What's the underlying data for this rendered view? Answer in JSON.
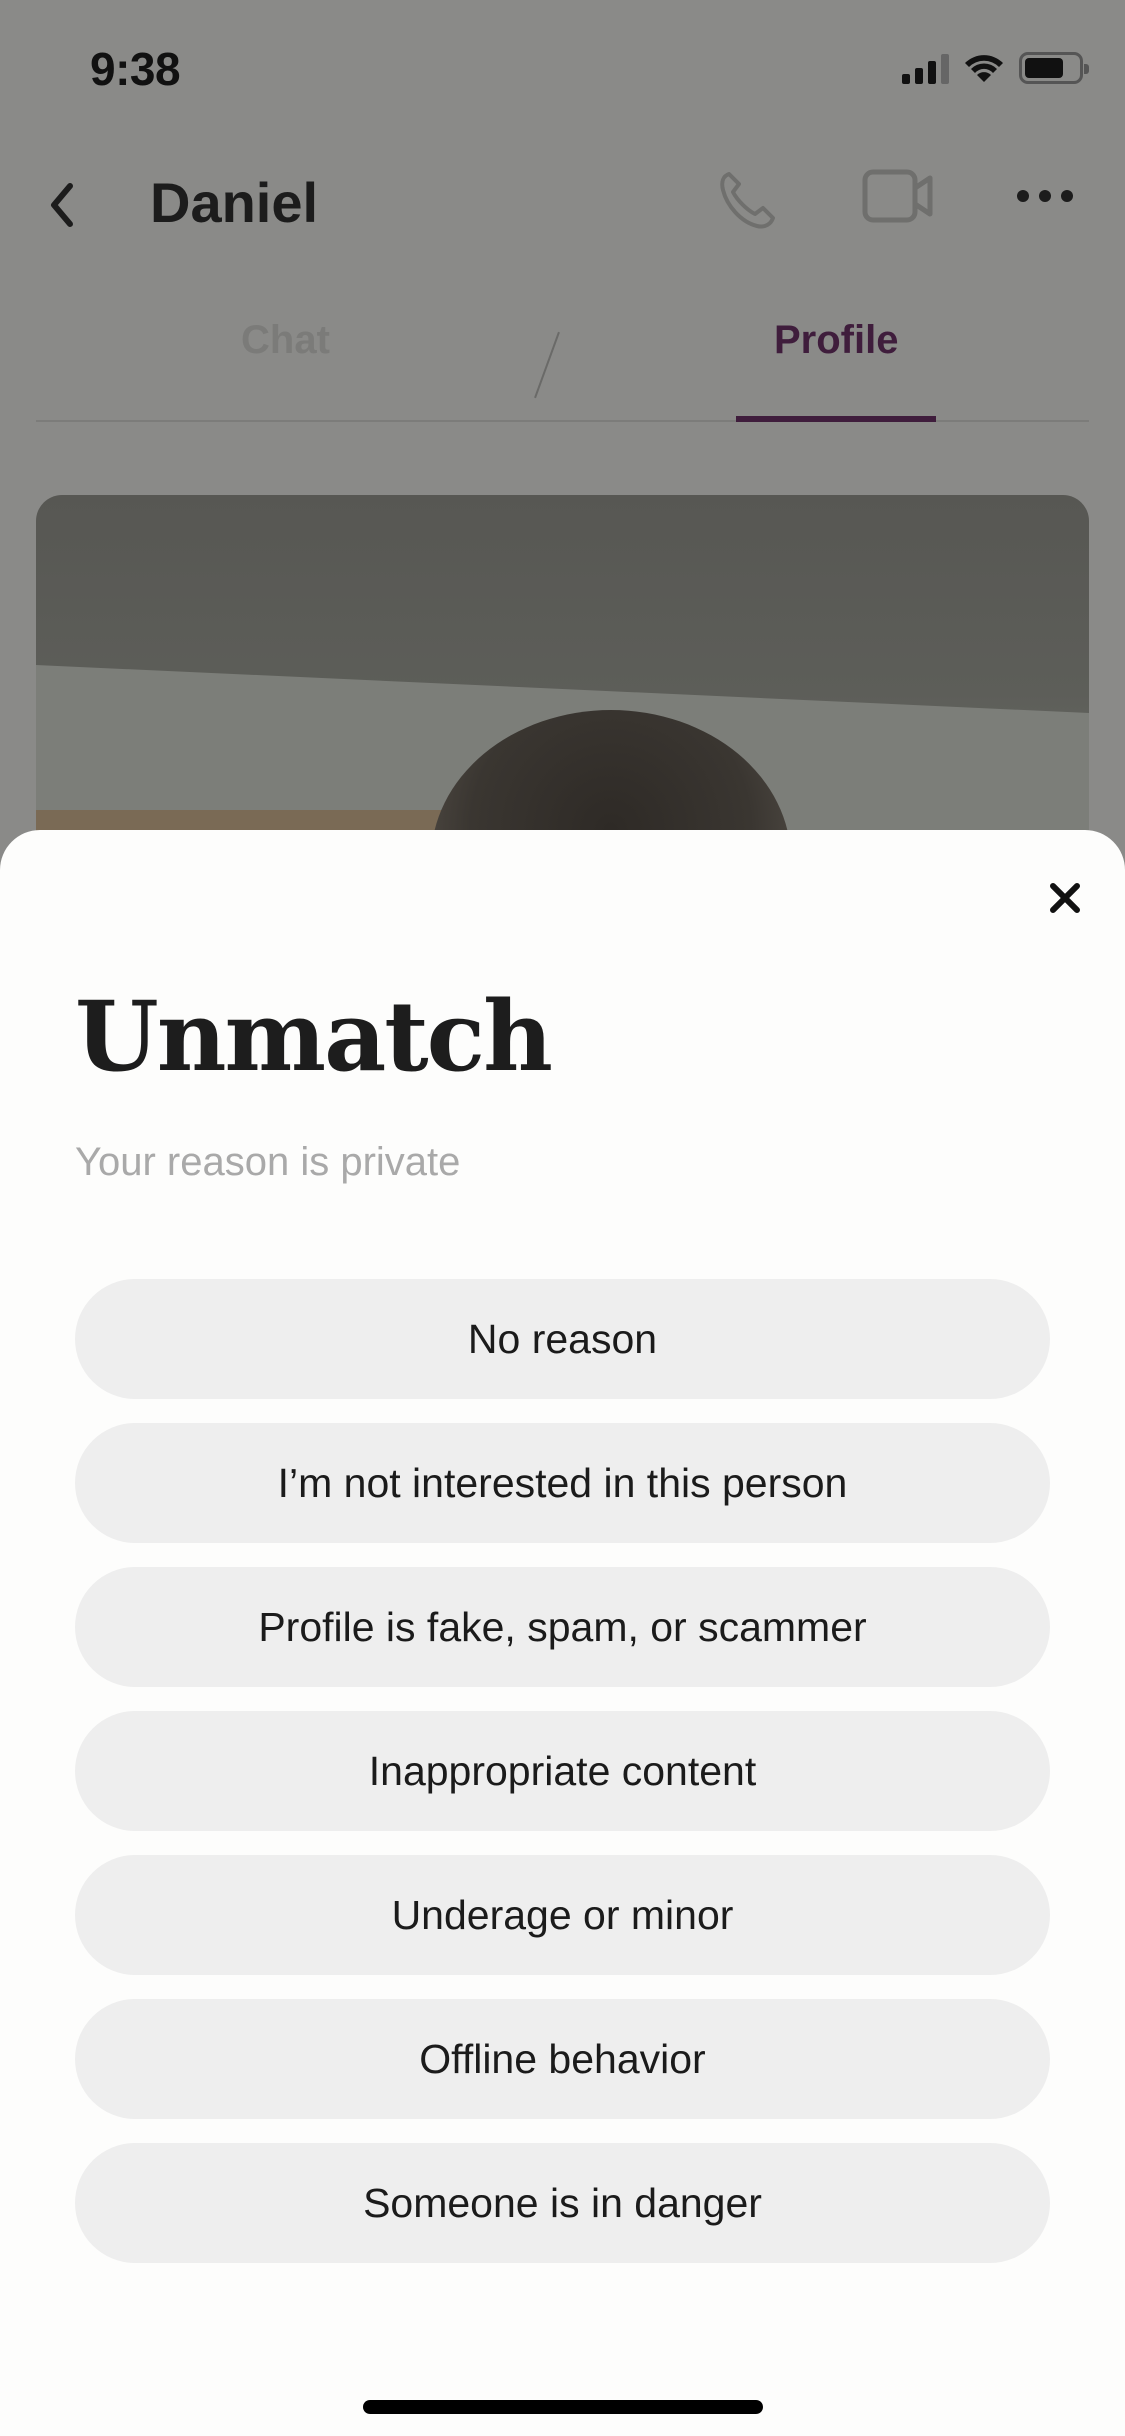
{
  "status_bar": {
    "time": "9:38",
    "signal_icon": "cellular-signal-icon",
    "wifi_icon": "wifi-icon",
    "battery_icon": "battery-icon",
    "battery_level": 0.7
  },
  "header": {
    "back_icon": "chevron-left-icon",
    "title": "Daniel",
    "actions": [
      {
        "name": "voice-call",
        "icon": "phone-icon"
      },
      {
        "name": "video-call",
        "icon": "video-camera-icon"
      },
      {
        "name": "more-options",
        "icon": "more-horizontal-icon"
      }
    ]
  },
  "tabs": [
    {
      "label": "Chat",
      "active": false
    },
    {
      "label": "Profile",
      "active": true
    }
  ],
  "colors": {
    "accent": "#3f1d3c",
    "option_background": "#eeeeee",
    "sheet_background": "#fdfdfc",
    "subtitle": "#a9a9a9"
  },
  "sheet": {
    "close_icon": "close-icon",
    "title": "Unmatch",
    "subtitle": "Your reason is private",
    "options": [
      "No reason",
      "I’m not interested in this person",
      "Profile is fake, spam, or scammer",
      "Inappropriate content",
      "Underage or minor",
      "Offline behavior",
      "Someone is in danger"
    ]
  }
}
